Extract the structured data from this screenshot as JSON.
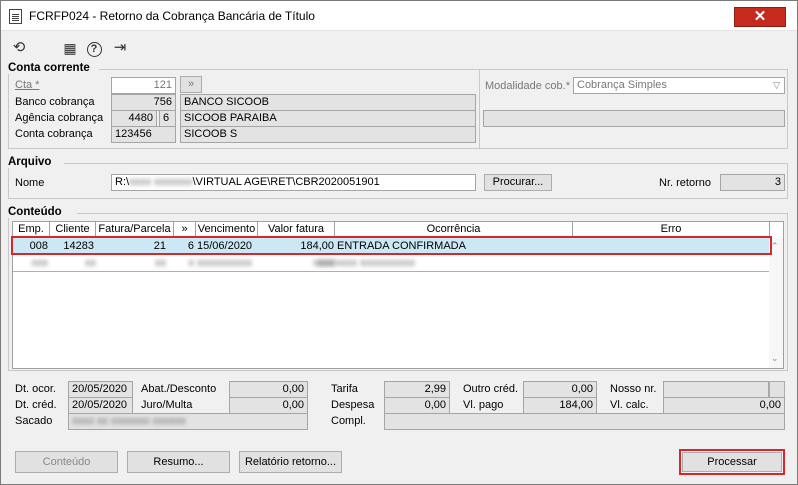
{
  "window": {
    "title": "FCRFP024 - Retorno da Cobrança Bancária de Título",
    "close_icon": "✕"
  },
  "toolbar": {
    "icons": [
      "refresh-icon",
      "calendar-icon",
      "help-icon",
      "exit-icon"
    ],
    "glyphs": {
      "refresh": "⟲",
      "calendar": "▦",
      "help": "?",
      "exit": "⇥"
    }
  },
  "conta_corrente": {
    "title": "Conta corrente",
    "cta_label": "Cta *",
    "cta_value": "121",
    "cta_button": "»",
    "banco_label": "Banco cobrança",
    "banco_code": "756",
    "banco_name": "BANCO SICOOB",
    "agencia_label": "Agência cobrança",
    "agencia_code": "4480",
    "agencia_digit": "6",
    "agencia_name": "SICOOB PARAIBA",
    "conta_label": "Conta cobrança",
    "conta_code": "123456",
    "conta_name": "SICOOB S",
    "modalidade_label": "Modalidade cob.*",
    "modalidade_value": "Cobrança Simples"
  },
  "arquivo": {
    "title": "Arquivo",
    "nome_label": "Nome",
    "path_prefix": "R:\\",
    "path_blurred": "xxxx xxxxxxx",
    "path_suffix": "\\VIRTUAL AGE\\RET\\CBR2020051901",
    "procurar_button": "Procurar...",
    "nr_retorno_label": "Nr. retorno",
    "nr_retorno_value": "3"
  },
  "conteudo": {
    "title": "Conteúdo",
    "columns": [
      "Emp.",
      "Cliente",
      "Fatura/Parcela",
      "»",
      "Vencimento",
      "Valor fatura",
      "Ocorrência",
      "Erro"
    ],
    "row1": {
      "emp": "008",
      "cliente": "14283",
      "fatura": "21",
      "parcela": "6",
      "vencimento": "15/06/2020",
      "valor": "184,00",
      "ocorrencia": "ENTRADA CONFIRMADA",
      "erro": ""
    },
    "row2": {
      "emp": "xxx",
      "cliente": "xx",
      "fatura": "xx",
      "parcela": "x",
      "vencimento": "xxxxxxxxxx",
      "valor": "xxx",
      "ocorrencia": "xxxxxxxx xxxxxxxxxx",
      "erro": ""
    }
  },
  "details": {
    "dt_ocor_label": "Dt. ocor.",
    "dt_ocor_value": "20/05/2020",
    "dt_cred_label": "Dt. créd.",
    "dt_cred_value": "20/05/2020",
    "sacado_label": "Sacado",
    "sacado_value": "xxxx xx xxxxxxx xxxxxx",
    "abat_label": "Abat./Desconto",
    "abat_value": "0,00",
    "juro_label": "Juro/Multa",
    "juro_value": "0,00",
    "tarifa_label": "Tarifa",
    "tarifa_value": "2,99",
    "despesa_label": "Despesa",
    "despesa_value": "0,00",
    "compl_label": "Compl.",
    "compl_value": "",
    "outro_label": "Outro créd.",
    "outro_value": "0,00",
    "vlpago_label": "Vl. pago",
    "vlpago_value": "184,00",
    "nossonr_label": "Nosso nr.",
    "nossonr_value": "",
    "vlcalc_label": "Vl. calc.",
    "vlcalc_value": "0,00"
  },
  "buttons": {
    "conteudo": "Conteúdo",
    "resumo": "Resumo...",
    "relatorio": "Relatório retorno...",
    "processar": "Processar"
  },
  "highlight_color": "#d9262b",
  "selection_color": "#cce8f4"
}
